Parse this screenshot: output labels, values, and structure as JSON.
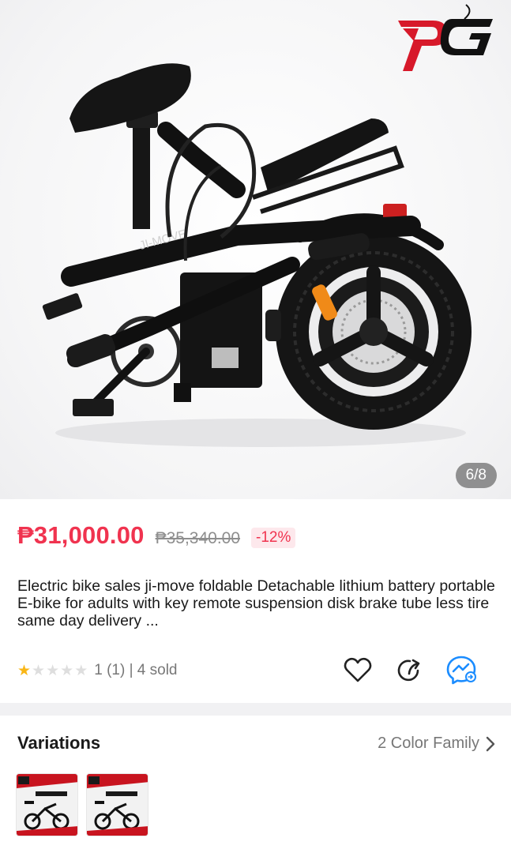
{
  "gallery": {
    "counter": "6/8",
    "frame_logo_text": "JI-MOVE",
    "colors": {
      "bike": "#121212",
      "background": "#f4f4f5",
      "logo_red": "#d7192a"
    },
    "brand_logo": {
      "icon": "pg-monogram-logo"
    }
  },
  "product": {
    "price": "₱31,000.00",
    "original_price": "₱35,340.00",
    "discount": "-12%",
    "title": "Electric bike sales ji-move foldable Detachable lithium battery portable E-bike for adults with key remote suspension disk brake tube less tire same day delivery ...",
    "rating": 1,
    "rating_max": 5,
    "rating_text": "1 (1) | 4 sold",
    "accent_color": "#f0334f"
  },
  "actions": {
    "favorite_icon": "heart-icon",
    "share_icon": "share-arrow-icon",
    "messenger_icon": "messenger-icon",
    "messenger_color": "#1a8cff"
  },
  "variations": {
    "title": "Variations",
    "link": "2 Color Family",
    "chevron_icon": "chevron-right-icon",
    "thumbnails": [
      "variation-thumb-1",
      "variation-thumb-2"
    ]
  }
}
